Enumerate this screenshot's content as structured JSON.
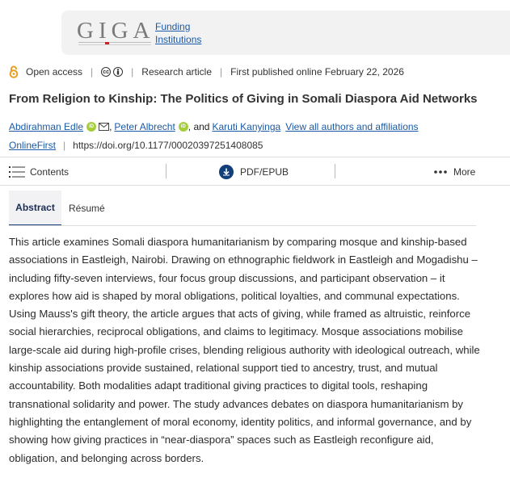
{
  "funding": {
    "logo_text": "GIGA",
    "link_line1": "Funding",
    "link_line2": "Institutions"
  },
  "meta": {
    "open_access": "Open access",
    "license_icons": [
      "cc-icon",
      "by-icon"
    ],
    "article_type": "Research article",
    "published": "First published online February 22, 2026"
  },
  "title": "From Religion to Kinship: The Politics of Giving in Somali Diaspora Aid Networks",
  "authors": {
    "list": [
      "Abdirahman Edle",
      "Peter Albrecht",
      "Karuti Kanyinga"
    ],
    "separator_1": ",",
    "separator_2": ", and",
    "view_all": "View all authors and affiliations"
  },
  "doi_row": {
    "status": "OnlineFirst",
    "doi": "https://doi.org/10.1177/00020397251408085"
  },
  "toolbar": {
    "contents": "Contents",
    "pdf": "PDF/EPUB",
    "more": "More"
  },
  "tabs": [
    "Abstract",
    "Résumé"
  ],
  "abstract": "This article examines Somali diaspora humanitarianism by comparing mosque and kinship-based associations in Eastleigh, Nairobi. Drawing on ethnographic fieldwork in Eastleigh and Mogadishu – including fifty-seven interviews, four focus group discussions, and participant observation – it explores how aid is shaped by moral obligations, political loyalties, and communal expectations. Using Mauss's gift theory, the article argues that acts of giving, while framed as altruistic, reinforce social hierarchies, reciprocal obligations, and claims to legitimacy. Mosque associations mobilise large-scale aid during high-profile crises, blending religious authority with ideological outreach, while kinship associations provide sustained, relational support tied to ancestry, trust, and mutual accountability. Both modalities adapt traditional giving practices to digital tools, reshaping transnational solidarity and power. The study advances debates on diaspora humanitarianism by highlighting the entanglement of moral economy, identity politics, and informal governance, and by showing how giving practices in “near-diaspora” spaces such as Eastleigh reconfigure aid, obligation, and belonging across borders.",
  "colors": {
    "link": "#1a5aa6",
    "accent": "#1b3f7a",
    "oa_orange": "#e8a022",
    "orcid": "#a6ce39"
  }
}
